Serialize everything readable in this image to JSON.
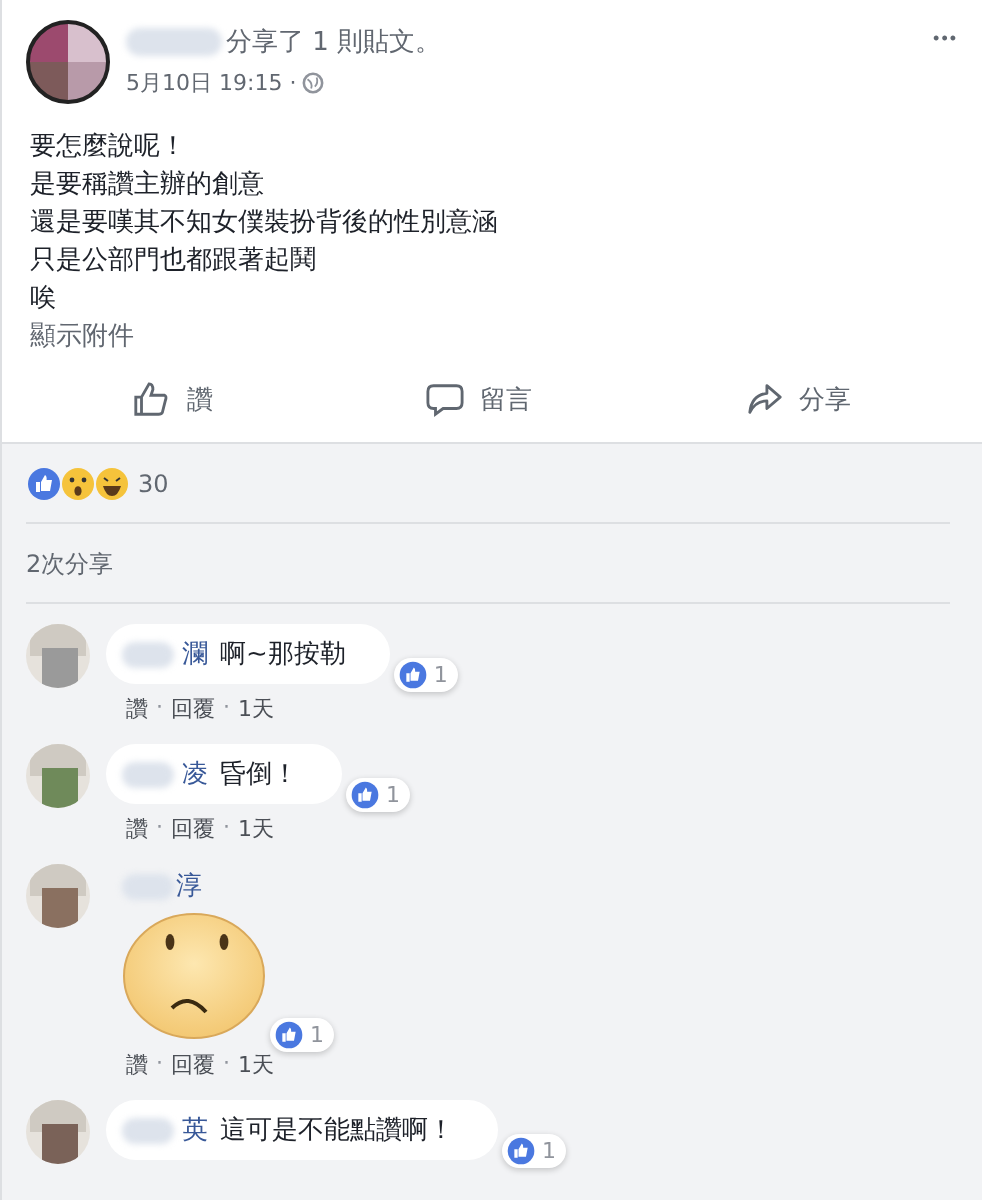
{
  "post": {
    "author_visible": "分享了 1 則貼文。",
    "time": "5月10日 19:15 ·",
    "more": "•••",
    "lines": [
      "要怎麼說呢！",
      "是要稱讚主辦的創意",
      "還是要嘆其不知女僕裝扮背後的性別意涵",
      "只是公部門也都跟著起鬨",
      "唉"
    ],
    "attachment_link": "顯示附件"
  },
  "actions": [
    {
      "kind": "like",
      "label": "讚"
    },
    {
      "kind": "comment",
      "label": "留言"
    },
    {
      "kind": "share",
      "label": "分享"
    }
  ],
  "reactions": {
    "count": "30"
  },
  "shares": "2次分享",
  "meta_separator": "·",
  "comments": [
    {
      "kind": "text",
      "name": "瀾",
      "text": "啊~那按勒",
      "likes": "1",
      "meta": [
        "讚",
        "回覆",
        "1天"
      ]
    },
    {
      "kind": "text",
      "name": "凌",
      "text": "昏倒！",
      "likes": "1",
      "meta": [
        "讚",
        "回覆",
        "1天"
      ]
    },
    {
      "kind": "sticker",
      "name": "淳",
      "likes": "1",
      "meta": [
        "讚",
        "回覆",
        "1天"
      ]
    },
    {
      "kind": "text",
      "name": "英",
      "text": "這可是不能點讚啊！",
      "likes": "1"
    }
  ]
}
